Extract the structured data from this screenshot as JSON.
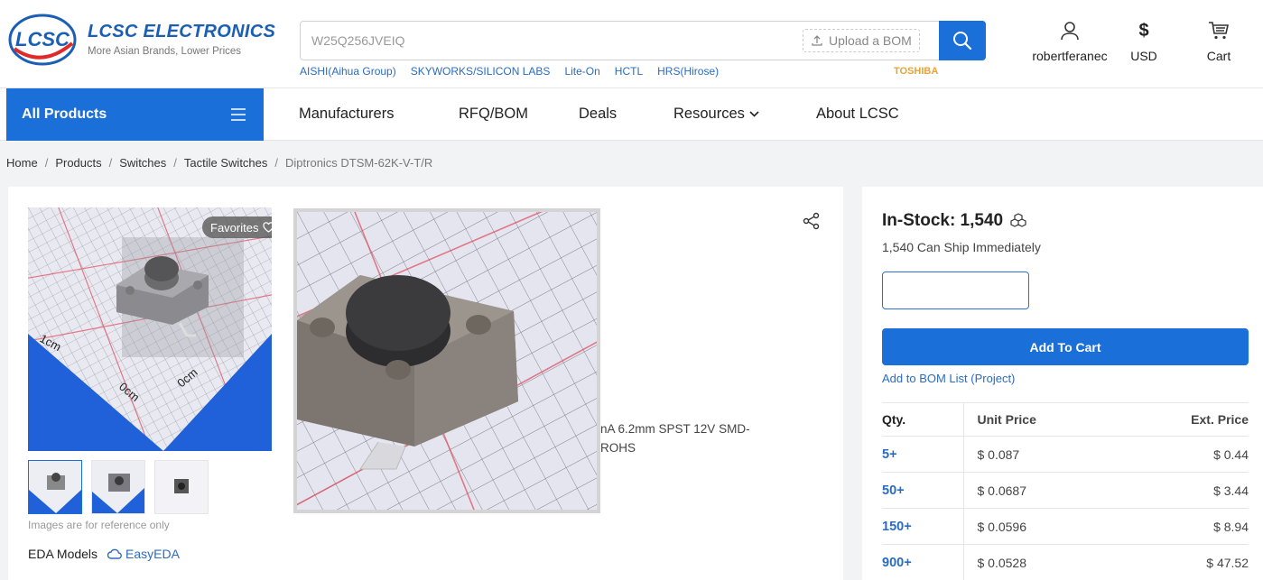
{
  "header": {
    "logo_mark": "LCSC",
    "logo_title": "LCSC ELECTRONICS",
    "logo_subtitle": "More Asian Brands, Lower Prices",
    "search": {
      "value": "W25Q256JVEIQ",
      "upload_label": "Upload a BOM"
    },
    "brand_links": [
      "AISHI(Aihua Group)",
      "SKYWORKS/SILICON LABS",
      "Lite-On",
      "HCTL",
      "HRS(Hirose)"
    ],
    "brand_highlight": "TOSHIBA",
    "user_label": "robertferanec",
    "currency_symbol": "$",
    "currency_label": "USD",
    "cart_label": "Cart"
  },
  "nav": {
    "all_products": "All Products",
    "items": [
      "Manufacturers",
      "RFQ/BOM",
      "Deals",
      "Resources",
      "About LCSC"
    ]
  },
  "breadcrumb": [
    "Home",
    "Products",
    "Switches",
    "Tactile Switches",
    "Diptronics DTSM-62K-V-T/R"
  ],
  "product": {
    "favorites_label": "Favorites",
    "image_note": "Images are for reference only",
    "eda_label": "EDA Models",
    "eda_link": "EasyEDA",
    "description_line1": "nA 6.2mm SPST 12V SMD-",
    "description_line2": "ROHS"
  },
  "buy": {
    "stock_title": "In-Stock: 1,540",
    "stock_sub": "1,540 Can Ship Immediately",
    "add_to_cart": "Add To Cart",
    "add_to_bom": "Add to BOM List (Project)",
    "table_headers": {
      "qty": "Qty.",
      "unit": "Unit Price",
      "ext": "Ext. Price"
    },
    "rows": [
      {
        "qty": "5+",
        "unit": "$ 0.087",
        "ext": "$ 0.44"
      },
      {
        "qty": "50+",
        "unit": "$ 0.0687",
        "ext": "$ 3.44"
      },
      {
        "qty": "150+",
        "unit": "$ 0.0596",
        "ext": "$ 8.94"
      },
      {
        "qty": "900+",
        "unit": "$ 0.0528",
        "ext": "$ 47.52"
      }
    ]
  },
  "colors": {
    "accent": "#1a6fd8",
    "link": "#2b6cc0",
    "brand_highlight": "#e8a33a"
  }
}
